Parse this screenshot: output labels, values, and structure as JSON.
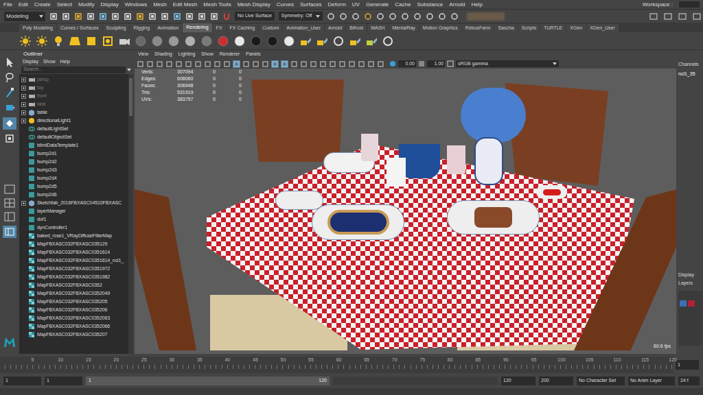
{
  "menu_bar": {
    "items": [
      "File",
      "Edit",
      "Create",
      "Select",
      "Modify",
      "Display",
      "Windows",
      "Mesh",
      "Edit Mesh",
      "Mesh Tools",
      "Mesh Display",
      "Curves",
      "Surfaces",
      "Deform",
      "UV",
      "Generate",
      "Cache",
      "Substance",
      "Arnold",
      "Help"
    ],
    "workspace": "Workspace :"
  },
  "status_line": {
    "mode": "Modeling",
    "live_surface": "No Live Surface",
    "symmetry": "Symmetry: Off"
  },
  "shelf": {
    "tabs": [
      {
        "label": "Poly Modeling",
        "selected": false
      },
      {
        "label": "Curves / Surfaces",
        "selected": false
      },
      {
        "label": "Sculpting",
        "selected": false
      },
      {
        "label": "Rigging",
        "selected": false
      },
      {
        "label": "Animation",
        "selected": false
      },
      {
        "label": "Rendering",
        "selected": true
      },
      {
        "label": "FX",
        "selected": false
      },
      {
        "label": "FX Caching",
        "selected": false
      },
      {
        "label": "Custom",
        "selected": false
      },
      {
        "label": "Animation_User",
        "selected": false
      },
      {
        "label": "Arnold",
        "selected": false
      },
      {
        "label": "Bifrost",
        "selected": false
      },
      {
        "label": "MASH",
        "selected": false
      },
      {
        "label": "MentalRay",
        "selected": false
      },
      {
        "label": "Motion Graphics",
        "selected": false
      },
      {
        "label": "RebusFarm",
        "selected": false
      },
      {
        "label": "Sascha",
        "selected": false
      },
      {
        "label": "Scripts",
        "selected": false
      },
      {
        "label": "TURTLE",
        "selected": false
      },
      {
        "label": "XGen",
        "selected": false
      },
      {
        "label": "XGen_User",
        "selected": false
      }
    ]
  },
  "outliner": {
    "title": "Outliner",
    "menu": [
      "Display",
      "Show",
      "Help"
    ],
    "search": {
      "placeholder": "Search..."
    },
    "items": [
      {
        "label": "persp",
        "kind": "camera",
        "dimmed": true,
        "expandable": true
      },
      {
        "label": "top",
        "kind": "camera",
        "dimmed": true,
        "expandable": true
      },
      {
        "label": "front",
        "kind": "camera",
        "dimmed": true,
        "expandable": true
      },
      {
        "label": "side",
        "kind": "camera",
        "dimmed": true,
        "expandable": true
      },
      {
        "label": "table",
        "kind": "mesh",
        "dimmed": false,
        "expandable": true
      },
      {
        "label": "directionalLight1",
        "kind": "light",
        "dimmed": false,
        "expandable": true
      },
      {
        "label": "defaultLightSet",
        "kind": "set",
        "dimmed": false,
        "expandable": false
      },
      {
        "label": "defaultObjectSet",
        "kind": "set",
        "dimmed": false,
        "expandable": false
      },
      {
        "label": "blindDataTemplate1",
        "kind": "node",
        "dimmed": false,
        "expandable": false
      },
      {
        "label": "bump2d1",
        "kind": "node",
        "dimmed": false,
        "expandable": false
      },
      {
        "label": "bump2d2",
        "kind": "node",
        "dimmed": false,
        "expandable": false
      },
      {
        "label": "bump2d3",
        "kind": "node",
        "dimmed": false,
        "expandable": false
      },
      {
        "label": "bump2d4",
        "kind": "node",
        "dimmed": false,
        "expandable": false
      },
      {
        "label": "bump2d5",
        "kind": "node",
        "dimmed": false,
        "expandable": false
      },
      {
        "label": "bump2d6",
        "kind": "node",
        "dimmed": false,
        "expandable": false
      },
      {
        "label": "Sketchfab_2016FBXASC04510FBXASC",
        "kind": "mesh",
        "dimmed": false,
        "expandable": true
      },
      {
        "label": "layerManager",
        "kind": "node",
        "dimmed": false,
        "expandable": false
      },
      {
        "label": "dof1",
        "kind": "node",
        "dimmed": false,
        "expandable": false
      },
      {
        "label": "dynController1",
        "kind": "node",
        "dimmed": false,
        "expandable": false
      },
      {
        "label": "baked_rose1_VRayDiffuseFilterMap",
        "kind": "texture",
        "dimmed": false,
        "expandable": false
      },
      {
        "label": "MapFBXASC032FBXASC035129",
        "kind": "texture",
        "dimmed": false,
        "expandable": false
      },
      {
        "label": "MapFBXASC032FBXASC0351614",
        "kind": "texture",
        "dimmed": false,
        "expandable": false
      },
      {
        "label": "MapFBXASC032FBXASC0351614_ncl1_",
        "kind": "texture",
        "dimmed": false,
        "expandable": false
      },
      {
        "label": "MapFBXASC032FBXASC0351972",
        "kind": "texture",
        "dimmed": false,
        "expandable": false
      },
      {
        "label": "MapFBXASC032FBXASC0351982",
        "kind": "texture",
        "dimmed": false,
        "expandable": false
      },
      {
        "label": "MapFBXASC032FBXASC0352",
        "kind": "texture",
        "dimmed": false,
        "expandable": false
      },
      {
        "label": "MapFBXASC032FBXASC0352049",
        "kind": "texture",
        "dimmed": false,
        "expandable": false
      },
      {
        "label": "MapFBXASC032FBXASC035205",
        "kind": "texture",
        "dimmed": false,
        "expandable": false
      },
      {
        "label": "MapFBXASC032FBXASC035206",
        "kind": "texture",
        "dimmed": false,
        "expandable": false
      },
      {
        "label": "MapFBXASC032FBXASC0352063",
        "kind": "texture",
        "dimmed": false,
        "expandable": false
      },
      {
        "label": "MapFBXASC032FBXASC0352066",
        "kind": "texture",
        "dimmed": false,
        "expandable": false
      },
      {
        "label": "MapFBXASC032FBXASC035207",
        "kind": "texture",
        "dimmed": false,
        "expandable": false
      }
    ]
  },
  "viewport": {
    "menu": [
      "View",
      "Shading",
      "Lighting",
      "Show",
      "Renderer",
      "Panels"
    ],
    "toolbar": {
      "exposure": "0.00",
      "gamma": "1.00",
      "color_space": "sRGB gamma"
    },
    "hud": [
      {
        "label": "Verts:",
        "values": [
          "307094",
          "0",
          "0"
        ]
      },
      {
        "label": "Edges:",
        "values": [
          "608060",
          "0",
          "0"
        ]
      },
      {
        "label": "Faces:",
        "values": [
          "306948",
          "0",
          "0"
        ]
      },
      {
        "label": "Tris:",
        "values": [
          "531919",
          "0",
          "0"
        ]
      },
      {
        "label": "UVs:",
        "values": [
          "383757",
          "0",
          "0"
        ]
      }
    ],
    "fps": "60.6 fps"
  },
  "channel_box": {
    "tab": "Channels",
    "object": "ncl1_35",
    "layer_tabs": [
      "Display",
      "Layers"
    ]
  },
  "timeline": {
    "ticks": [
      "5",
      "10",
      "15",
      "20",
      "25",
      "30",
      "35",
      "40",
      "45",
      "50",
      "55",
      "60",
      "65",
      "70",
      "75",
      "80",
      "85",
      "90",
      "95",
      "100",
      "105",
      "110",
      "115",
      "120"
    ],
    "current": "1"
  },
  "range": {
    "start": "1",
    "playback_start": "1",
    "slider_start": "1",
    "slider_end": "120",
    "playback_end": "120",
    "end": "200",
    "character_set": "No Character Set",
    "anim_layer": "No Anim Layer",
    "fps": "24 f"
  }
}
